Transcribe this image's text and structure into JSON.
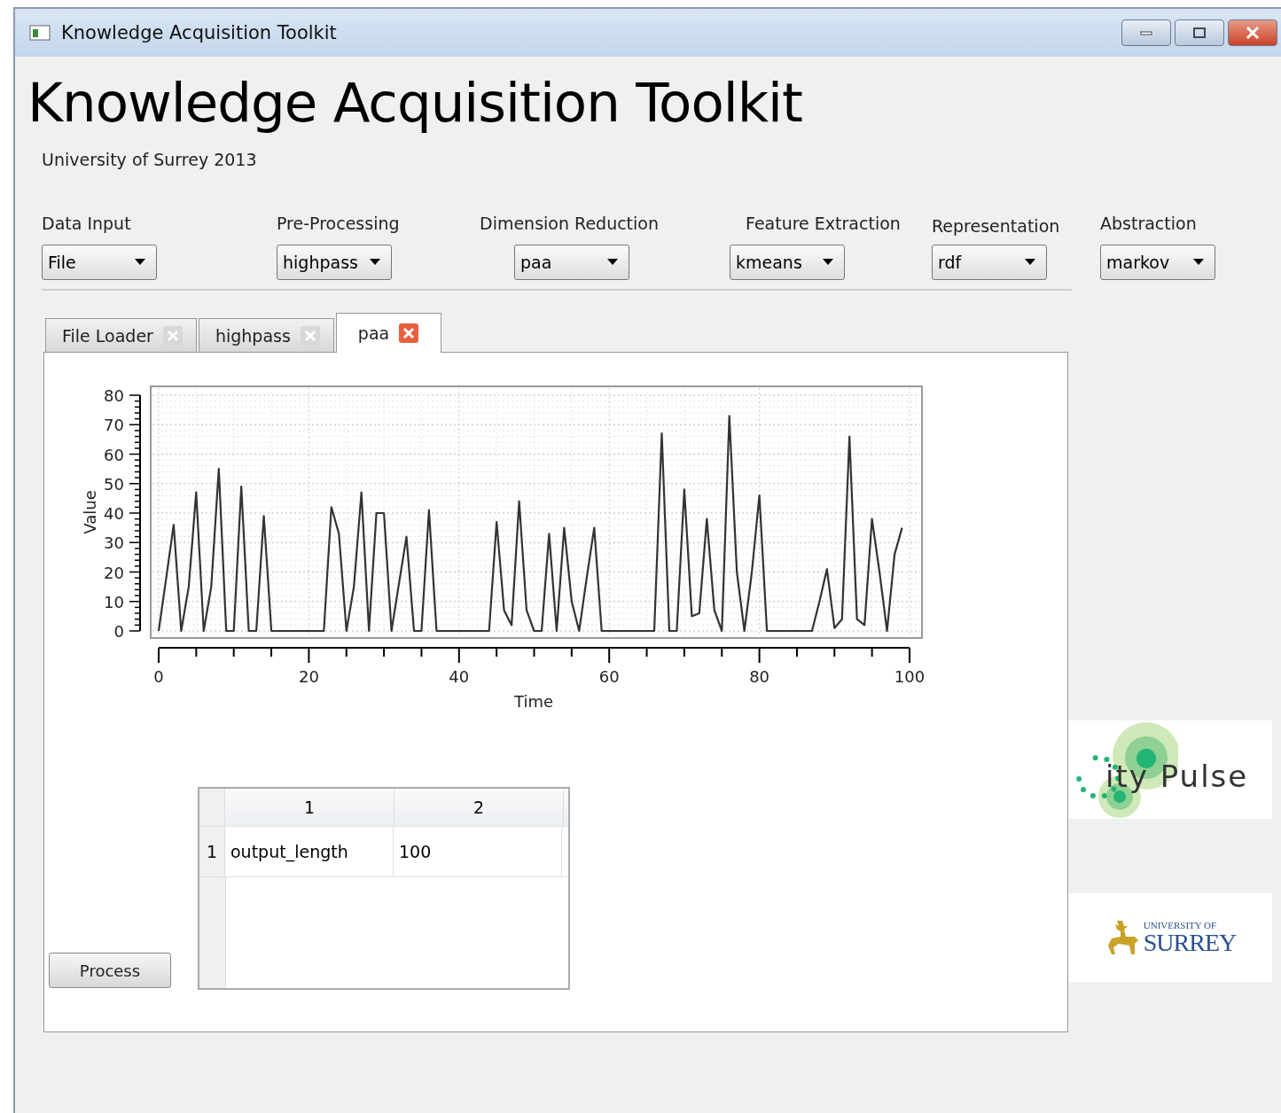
{
  "window": {
    "title": "Knowledge Acquisition Toolkit"
  },
  "header": {
    "title": "Knowledge Acquisition Toolkit",
    "subtitle": "University of Surrey 2013"
  },
  "pipeline": [
    {
      "label": "Data Input",
      "value": "File"
    },
    {
      "label": "Pre-Processing",
      "value": "highpass"
    },
    {
      "label": "Dimension Reduction",
      "value": "paa"
    },
    {
      "label": "Feature Extraction",
      "value": "kmeans"
    },
    {
      "label": "Representation",
      "value": "rdf"
    },
    {
      "label": "Abstraction",
      "value": "markov"
    }
  ],
  "tabs": [
    {
      "label": "File Loader",
      "selected": false
    },
    {
      "label": "highpass",
      "selected": false
    },
    {
      "label": "paa",
      "selected": true
    }
  ],
  "chart_data": {
    "type": "line",
    "grid": true,
    "xlabel": "Time",
    "ylabel": "Value",
    "xlim": [
      0,
      100
    ],
    "ylim": [
      0,
      80
    ],
    "xticks": [
      0,
      20,
      40,
      60,
      80,
      100
    ],
    "yticks": [
      0,
      10,
      20,
      30,
      40,
      50,
      60,
      70,
      80
    ],
    "x": [
      0,
      1,
      2,
      3,
      4,
      5,
      6,
      7,
      8,
      9,
      10,
      11,
      12,
      13,
      14,
      15,
      16,
      17,
      18,
      19,
      20,
      21,
      22,
      23,
      24,
      25,
      26,
      27,
      28,
      29,
      30,
      31,
      32,
      33,
      34,
      35,
      36,
      37,
      38,
      39,
      40,
      41,
      42,
      43,
      44,
      45,
      46,
      47,
      48,
      49,
      50,
      51,
      52,
      53,
      54,
      55,
      56,
      57,
      58,
      59,
      60,
      61,
      62,
      63,
      64,
      65,
      66,
      67,
      68,
      69,
      70,
      71,
      72,
      73,
      74,
      75,
      76,
      77,
      78,
      79,
      80,
      81,
      82,
      83,
      84,
      85,
      86,
      87,
      88,
      89,
      90,
      91,
      92,
      93,
      94,
      95,
      96,
      97,
      98,
      99
    ],
    "series": [
      {
        "color": "#333333",
        "values": [
          0,
          18,
          36,
          0,
          15,
          47,
          0,
          15,
          55,
          0,
          0,
          49,
          0,
          0,
          39,
          0,
          0,
          0,
          0,
          0,
          0,
          0,
          0,
          42,
          33,
          0,
          15,
          47,
          0,
          40,
          40,
          0,
          16,
          32,
          0,
          0,
          41,
          0,
          0,
          0,
          0,
          0,
          0,
          0,
          0,
          37,
          7,
          2,
          44,
          7,
          0,
          0,
          33,
          0,
          35,
          10,
          0,
          18,
          35,
          0,
          0,
          0,
          0,
          0,
          0,
          0,
          0,
          67,
          0,
          0,
          48,
          5,
          6,
          38,
          7,
          0,
          73,
          20,
          0,
          20,
          46,
          0,
          0,
          0,
          0,
          0,
          0,
          0,
          10,
          21,
          1,
          4,
          66,
          4,
          2,
          38,
          20,
          0,
          26,
          35
        ]
      }
    ]
  },
  "table": {
    "columns": [
      "1",
      "2"
    ],
    "rows": [
      {
        "header": "1",
        "cells": [
          "output_length",
          "100"
        ]
      }
    ]
  },
  "process_button": "Process",
  "logos": [
    {
      "kind": "citypulse",
      "text": "ity Pulse"
    },
    {
      "kind": "surrey",
      "lines": [
        "UNIVERSITY OF",
        "SURREY"
      ]
    }
  ]
}
